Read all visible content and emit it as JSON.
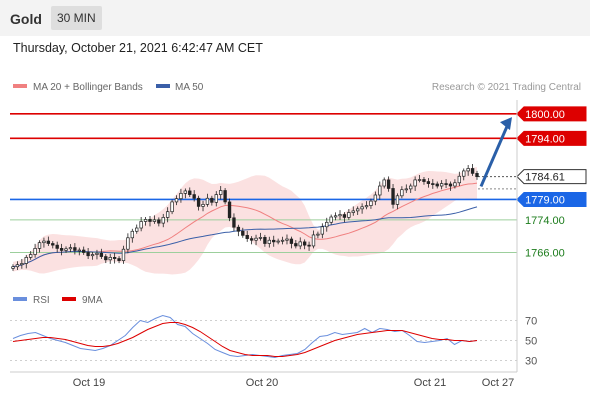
{
  "header": {
    "symbol": "Gold",
    "timeframe": "30 MIN"
  },
  "datetime": "Thursday, October 21, 2021 6:42:47 AM CET",
  "legend": {
    "ma20_label": "MA 20 + Bollinger Bands",
    "ma50_label": "MA 50",
    "credit": "Research © 2021 Trading Central"
  },
  "colors": {
    "resistance": "#dd0000",
    "support": "#1a66e6",
    "target": "#1c7c1c",
    "arrow": "#2a5fa8",
    "band": "#fbdede",
    "ma20": "#f08080",
    "ma50": "#3a5fa8",
    "rsi": "#6a8fdd",
    "rsi_ma": "#dd0000"
  },
  "chart_data": [
    {
      "type": "candlestick",
      "ylim": [
        1761.7,
        1803.4
      ],
      "x_ticks": [
        "Oct 19",
        "Oct 20",
        "Oct 21",
        "Oct 27"
      ],
      "close": [
        1762.5,
        1763,
        1763.3,
        1764.8,
        1765.5,
        1767,
        1768.4,
        1768.8,
        1768.2,
        1767.8,
        1767,
        1766.5,
        1766.9,
        1767.2,
        1766.5,
        1766.6,
        1766,
        1765.2,
        1765.5,
        1765.8,
        1765,
        1764.2,
        1764.8,
        1764.5,
        1764,
        1766.8,
        1769.6,
        1771.2,
        1772,
        1773.6,
        1774.1,
        1773.6,
        1774,
        1773.2,
        1774.6,
        1776,
        1778.4,
        1779.2,
        1780.5,
        1781.1,
        1780.2,
        1779.3,
        1777.3,
        1777.8,
        1779.3,
        1778.3,
        1780.2,
        1781.2,
        1778.4,
        1774.5,
        1772.2,
        1771.2,
        1770.2,
        1769.4,
        1769,
        1769.5,
        1769.7,
        1768.2,
        1769,
        1768.6,
        1768.8,
        1769,
        1769.3,
        1768.2,
        1767.6,
        1768.6,
        1767.8,
        1767.6,
        1770.3,
        1770.5,
        1772.3,
        1773.4,
        1774.7,
        1775,
        1775.3,
        1774.6,
        1775.8,
        1776.2,
        1776.7,
        1777.2,
        1777.5,
        1778.6,
        1780.1,
        1782.3,
        1783.8,
        1781.7,
        1777.8,
        1779.9,
        1781.4,
        1781.6,
        1782.3,
        1783.8,
        1783.9,
        1783.4,
        1782.9,
        1782.8,
        1782.3,
        1782.9,
        1782.8,
        1782.3,
        1783.1,
        1784.7,
        1786,
        1786.6,
        1785.4,
        1784.6
      ],
      "ohlc_note": "close prices estimated from candle bodies",
      "series": [
        {
          "name": "MA 20 + Bollinger Bands"
        },
        {
          "name": "MA 50"
        }
      ],
      "levels": [
        {
          "value": 1800.0,
          "label": "1800.00",
          "kind": "resistance"
        },
        {
          "value": 1794.0,
          "label": "1794.00",
          "kind": "resistance"
        },
        {
          "value": 1784.61,
          "label": "1784.61",
          "kind": "last"
        },
        {
          "value": 1779.0,
          "label": "1779.00",
          "kind": "support"
        },
        {
          "value": 1774.0,
          "label": "1774.00",
          "kind": "target"
        },
        {
          "value": 1766.0,
          "label": "1766.00",
          "kind": "target"
        }
      ]
    },
    {
      "type": "line",
      "legend": [
        "RSI",
        "9MA"
      ],
      "ylim": [
        22.5,
        77.5
      ],
      "yticks": [
        "70",
        "50",
        "30"
      ],
      "ytick_values": [
        70,
        50,
        30
      ],
      "rsi": [
        52,
        55,
        57,
        58,
        55,
        52,
        50,
        48,
        45,
        42,
        41,
        40,
        42,
        45,
        50,
        55,
        63,
        70,
        68,
        72,
        75,
        73,
        66,
        64,
        57,
        52,
        47,
        41,
        38,
        35,
        34,
        35,
        36,
        35,
        34,
        33,
        35,
        36,
        37,
        41,
        48,
        54,
        55,
        58,
        56,
        57,
        58,
        62,
        58,
        62,
        61,
        59,
        60,
        55,
        49,
        48,
        49,
        50,
        52,
        46,
        50,
        49,
        50
      ],
      "rsi_ma": [
        49,
        50,
        51,
        52,
        53,
        53,
        52,
        51,
        49,
        47,
        45,
        44,
        44,
        45,
        47,
        50,
        53,
        57,
        61,
        64,
        67,
        68,
        68,
        66,
        63,
        59,
        54,
        49,
        44,
        40,
        38,
        36,
        35,
        35,
        35,
        34,
        34,
        35,
        36,
        38,
        41,
        44,
        47,
        50,
        52,
        54,
        56,
        57,
        58,
        59,
        60,
        60,
        60,
        58,
        56,
        54,
        52,
        51,
        51,
        50,
        50,
        49,
        50
      ]
    }
  ]
}
